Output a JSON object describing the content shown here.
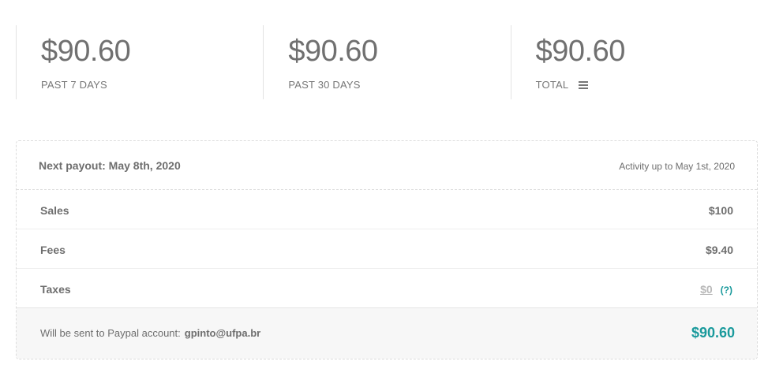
{
  "stats": [
    {
      "amount": "$90.60",
      "label": "PAST 7 DAYS"
    },
    {
      "amount": "$90.60",
      "label": "PAST 30 DAYS"
    },
    {
      "amount": "$90.60",
      "label": "TOTAL",
      "icon": "menu-icon"
    }
  ],
  "payout": {
    "title": "Next payout: May 8th, 2020",
    "activity": "Activity up to May 1st, 2020",
    "rows": [
      {
        "name": "Sales",
        "value": "$100"
      },
      {
        "name": "Fees",
        "value": "$9.40"
      },
      {
        "name": "Taxes",
        "value": "$0",
        "help": "(?)"
      }
    ],
    "footer": {
      "sent_label": "Will be sent to Paypal account:",
      "email": "gpinto@ufpa.br",
      "total": "$90.60"
    }
  },
  "colors": {
    "accent": "#1a9a9c",
    "text": "#6e6e6e",
    "muted": "#b8b8b8",
    "footer_bg": "#f7f7f7"
  }
}
